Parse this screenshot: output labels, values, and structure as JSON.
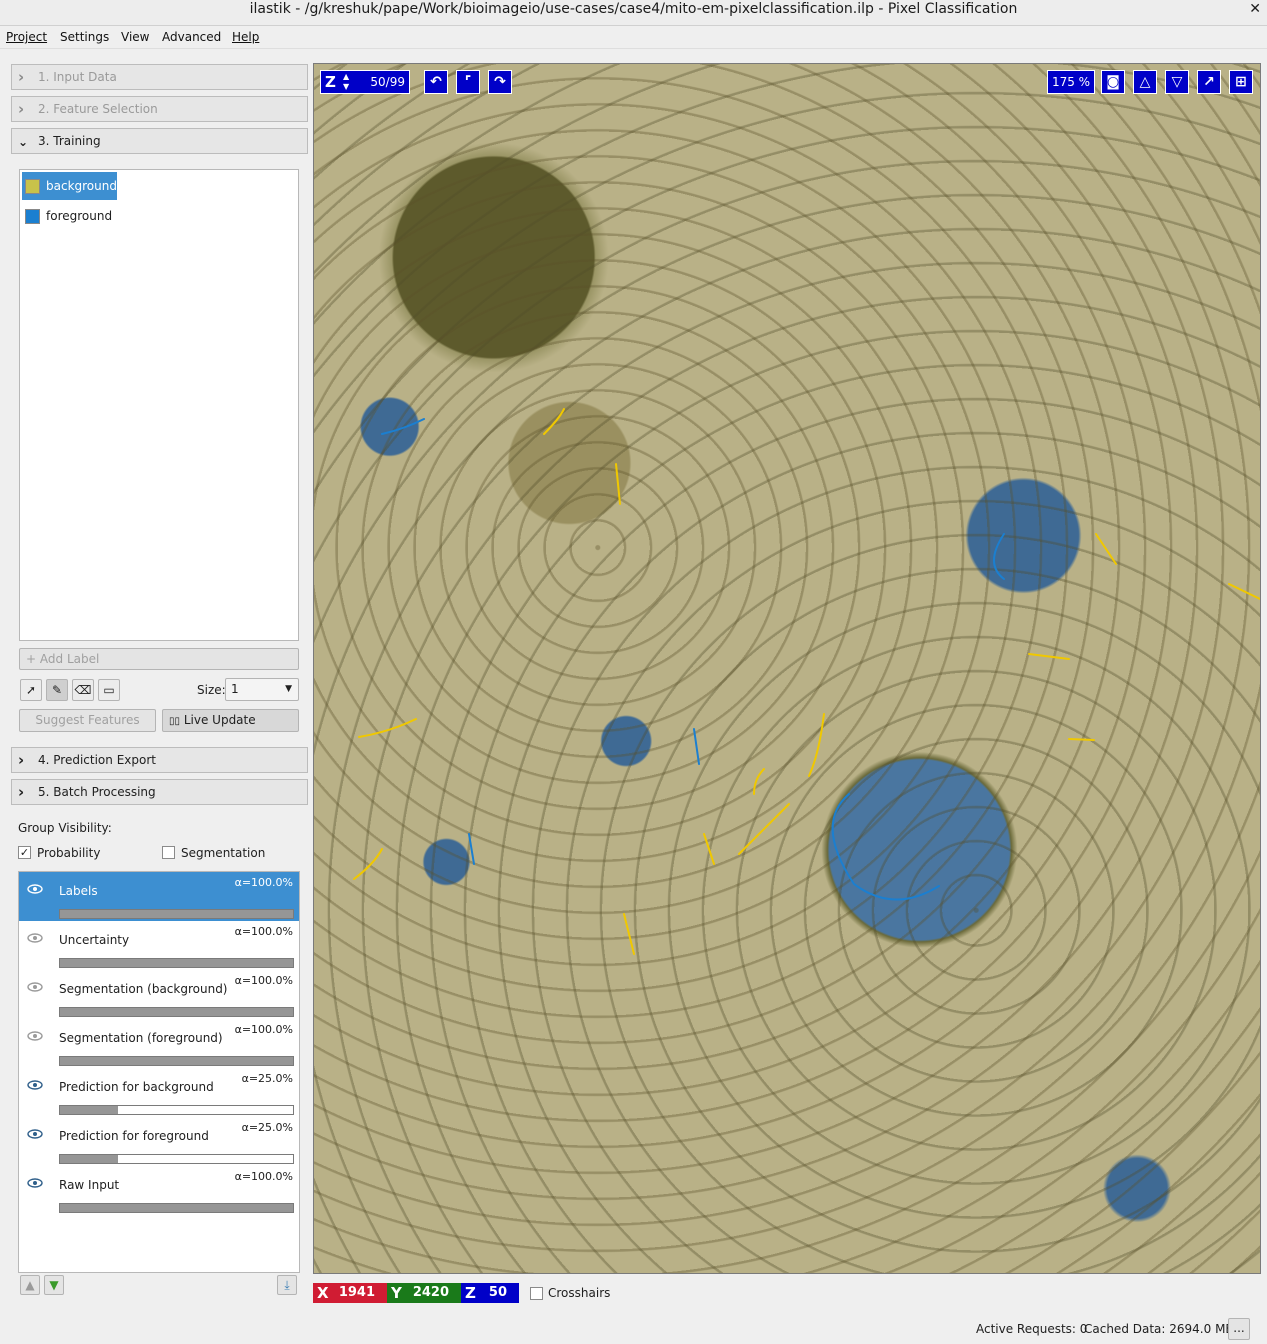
{
  "window": {
    "title": "ilastik - /g/kreshuk/pape/Work/bioimageio/use-cases/case4/mito-em-pixelclassification.ilp - Pixel Classification"
  },
  "menu": [
    "Project",
    "Settings",
    "View",
    "Advanced",
    "Help"
  ],
  "applets": {
    "input_data": "1. Input Data",
    "feature_selection": "2. Feature Selection",
    "training": "3. Training",
    "prediction_export": "4. Prediction Export",
    "batch_processing": "5. Batch Processing"
  },
  "labels": [
    {
      "name": "background",
      "color": "#c8c24a"
    },
    {
      "name": "foreground",
      "color": "#1b7fd0"
    }
  ],
  "training": {
    "add_label": "Add Label",
    "size_label": "Size:",
    "size_value": "1",
    "suggest_features": "Suggest Features",
    "live_update": "Live Update"
  },
  "group_visibility": {
    "title": "Group Visibility:",
    "probability": "Probability",
    "segmentation": "Segmentation"
  },
  "layers": [
    {
      "name": "Labels",
      "alpha": "α=100.0%",
      "fill": 1.0
    },
    {
      "name": "Uncertainty",
      "alpha": "α=100.0%",
      "fill": 1.0
    },
    {
      "name": "Segmentation (background)",
      "alpha": "α=100.0%",
      "fill": 1.0
    },
    {
      "name": "Segmentation (foreground)",
      "alpha": "α=100.0%",
      "fill": 1.0
    },
    {
      "name": "Prediction for background",
      "alpha": "α=25.0%",
      "fill": 0.25
    },
    {
      "name": "Prediction for foreground",
      "alpha": "α=25.0%",
      "fill": 0.25
    },
    {
      "name": "Raw Input",
      "alpha": "α=100.0%",
      "fill": 1.0
    }
  ],
  "viewer": {
    "z_axis": "Z",
    "slice": "50/99",
    "zoom": "175 %"
  },
  "coords": {
    "x_label": "X",
    "x": "1941",
    "y_label": "Y",
    "y": "2420",
    "z_label": "Z",
    "z": "50",
    "crosshairs": "Crosshairs"
  },
  "status": {
    "active_requests": "Active Requests: 0",
    "cached_data": "Cached Data: 2694.0 MB",
    "more": "..."
  },
  "colors": {
    "selection": "#3d8fd1",
    "hud": "#0000c8",
    "x_axis": "#d01c33",
    "y_axis": "#1a7a1a",
    "z_axis": "#0000c8"
  }
}
